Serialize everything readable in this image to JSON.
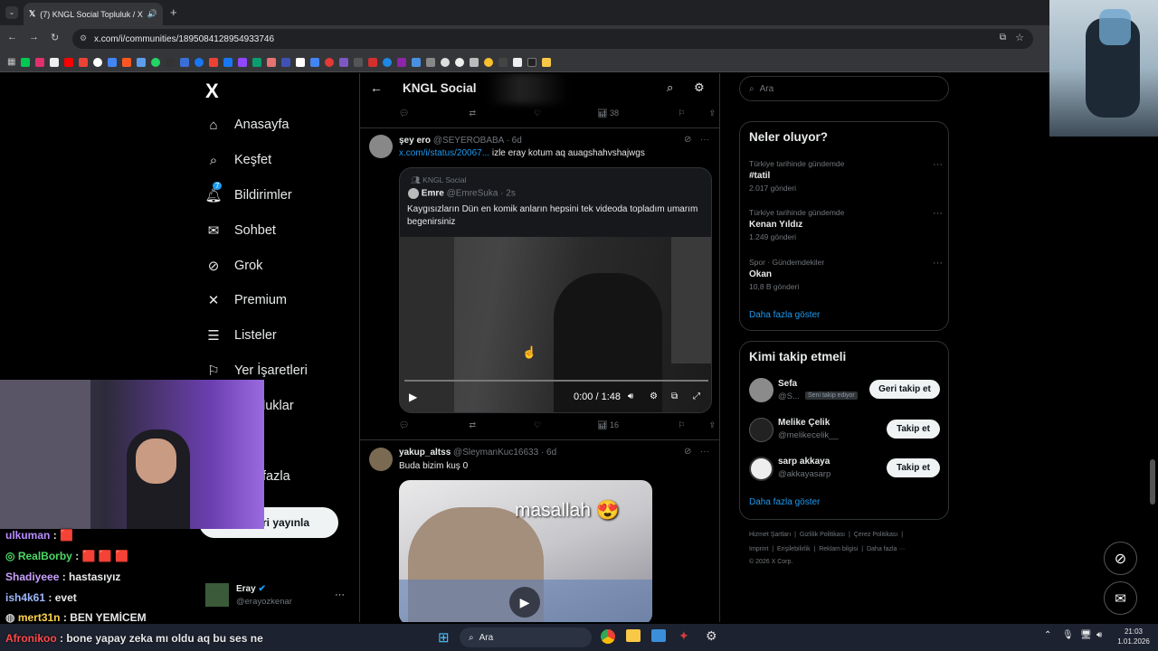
{
  "browser": {
    "tab_title": "(7) KNGL Social Topluluk / X",
    "new_tab": "+",
    "url": "x.com/i/communities/1895084128954933746"
  },
  "sidebar": {
    "logo": "X",
    "items": [
      {
        "label": "Anasayfa",
        "icon": "home-icon"
      },
      {
        "label": "Keşfet",
        "icon": "search-icon"
      },
      {
        "label": "Bildirimler",
        "icon": "bell-icon",
        "badge": "7"
      },
      {
        "label": "Sohbet",
        "icon": "mail-icon"
      },
      {
        "label": "Grok",
        "icon": "grok-icon"
      },
      {
        "label": "Premium",
        "icon": "x-icon"
      },
      {
        "label": "Listeler",
        "icon": "list-icon"
      },
      {
        "label": "Yer İşaretleri",
        "icon": "bookmark-icon"
      },
      {
        "label": "luklar",
        "icon": "community-icon"
      },
      {
        "label": "fazla",
        "icon": "more-icon"
      }
    ],
    "post_button": "ri yayınla",
    "account": {
      "name": "Eray",
      "handle": "@erayozkenar",
      "more": "···"
    }
  },
  "feed": {
    "header_title": "KNGL Social",
    "top_post_actions": {
      "views": "38"
    },
    "post1": {
      "author": "şey ero",
      "handle": "@SEYEROBABA",
      "time": "· 6d",
      "link_text": "x.com/i/status/20067...",
      "text": " izle eray kotum aq auagshahvshajwgs",
      "quoted": {
        "community": "KNGL Social",
        "author": "Emre",
        "handle": "@EmreSuka",
        "time": "· 2s",
        "text": "Kaygısızların Dün en komik anların hepsini tek videoda topladım umarım begenirsiniz",
        "video_time": "0:00 / 1:48"
      },
      "views": "16"
    },
    "post2": {
      "author": "yakup_altss",
      "handle": "@SleymanKuc16633",
      "time": "· 6d",
      "text": "Buda bizim kuş 0",
      "image_caption": "masallah 😍"
    }
  },
  "right": {
    "search_placeholder": "Ara",
    "trends_title": "Neler oluyor?",
    "trends": [
      {
        "context": "Türkiye tarihinde gündemde",
        "name": "#tatil",
        "count": "2.017 gönderi"
      },
      {
        "context": "Türkiye tarihinde gündemde",
        "name": "Kenan Yıldız",
        "count": "1.249 gönderi"
      },
      {
        "context": "Spor · Gündemdekiler",
        "name": "Okan",
        "count": "10,8 B gönderi"
      }
    ],
    "show_more": "Daha fazla göster",
    "who_title": "Kimi takip etmeli",
    "who": [
      {
        "name": "Sefa",
        "handle": "@S...",
        "badge": "Seni takip ediyor",
        "button": "Geri takip et"
      },
      {
        "name": "Melike Çelik",
        "handle": "@melikecelik__",
        "button": "Takip et"
      },
      {
        "name": "sarp akkaya",
        "handle": "@akkayasarp",
        "button": "Takip et"
      }
    ],
    "who_more": "Daha fazla göster",
    "footer_row1": [
      "Hizmet Şartları",
      "Gizlilik Politikası",
      "Çerez Politikası"
    ],
    "footer_row2": [
      "Imprint",
      "Erişilebilirlik",
      "Reklam bilgisi",
      "Daha fazla ···"
    ],
    "copyright": "© 2026 X Corp."
  },
  "chat": [
    {
      "user": "ulkuman",
      "msg": ": 🟥",
      "color": "#b98cff"
    },
    {
      "user": "RealBorby",
      "msg": ": 🟥 🟥 🟥",
      "color": "#4cd964"
    },
    {
      "user": "Shadiyeee",
      "msg": ": hastasıyız",
      "color": "#c9a0ff"
    },
    {
      "user": "ish4k61",
      "msg": ": evet",
      "color": "#9fb8ff"
    },
    {
      "user": "mert31n",
      "msg": ": BEN YEMİCEM",
      "color": "#ffd34d"
    },
    {
      "user": "Afronikoo",
      "msg": ": bone yapay zeka mı oldu aq bu ses ne",
      "color": "#ff4b4b"
    }
  ],
  "taskbar": {
    "search": "Ara",
    "time": "21:03",
    "date": "1.01.2026"
  }
}
